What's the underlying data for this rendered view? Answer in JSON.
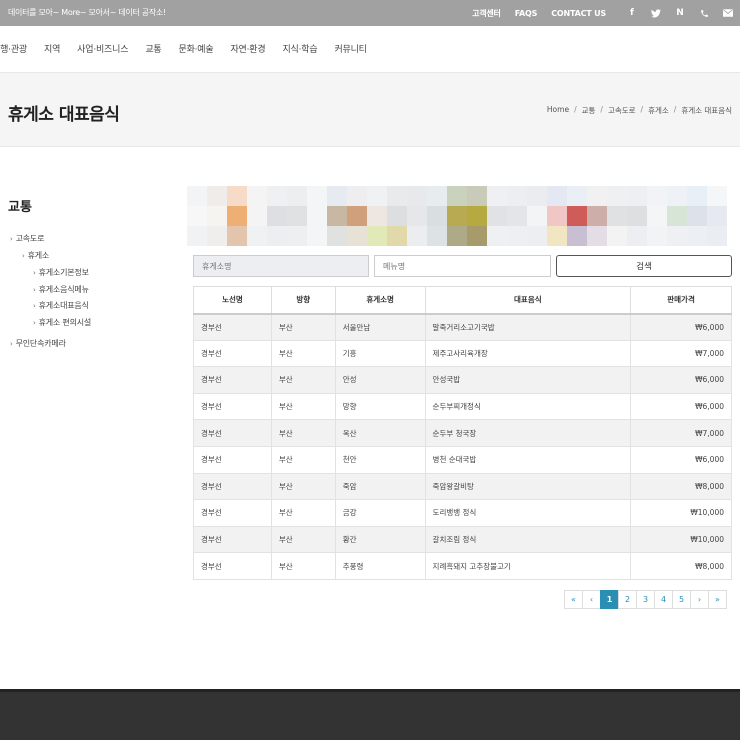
{
  "topbar": {
    "slogan": "데이터를 모아~ More~ 모아서~ 데이터 공작소!",
    "links": [
      "고객센터",
      "FAQS",
      "CONTACT US"
    ],
    "social_icons": [
      {
        "name": "facebook-icon",
        "glyph": "f"
      },
      {
        "name": "twitter-icon",
        "glyph": "🐦"
      },
      {
        "name": "naver-icon",
        "glyph": "N"
      },
      {
        "name": "phone-icon",
        "glyph": "✆"
      },
      {
        "name": "mail-icon",
        "glyph": "✉"
      }
    ]
  },
  "nav": {
    "items": [
      "여행·관광",
      "지역",
      "사업·비즈니스",
      "교통",
      "문화·예술",
      "자연·환경",
      "지식·학습",
      "커뮤니티"
    ]
  },
  "page": {
    "title": "휴게소 대표음식",
    "breadcrumb": [
      "Home",
      "교통",
      "고속도로",
      "휴게소",
      "휴게소 대표음식"
    ]
  },
  "sidebar": {
    "title": "교통",
    "items": [
      {
        "label": "고속도로",
        "level": 1
      },
      {
        "label": "휴게소",
        "level": 2
      },
      {
        "label": "휴게소기본정보",
        "level": 3
      },
      {
        "label": "휴게소음식메뉴",
        "level": 3
      },
      {
        "label": "휴게소대표음식",
        "level": 3
      },
      {
        "label": "휴게소 편의시설",
        "level": 3
      },
      {
        "label": "무인단속카메라",
        "level": 1
      }
    ]
  },
  "search": {
    "rest_area_placeholder": "휴게소명",
    "menu_placeholder": "메뉴명",
    "button_label": "검색"
  },
  "table": {
    "headers": [
      "노선명",
      "방향",
      "휴게소명",
      "대표음식",
      "판매가격"
    ],
    "rows": [
      [
        "경부선",
        "부산",
        "서울만남",
        "말죽거리소고기국밥",
        "₩6,000"
      ],
      [
        "경부선",
        "부산",
        "기흥",
        "제주고사리육개장",
        "₩7,000"
      ],
      [
        "경부선",
        "부산",
        "안성",
        "안성국밥",
        "₩6,000"
      ],
      [
        "경부선",
        "부산",
        "망향",
        "순두부찌개정식",
        "₩6,000"
      ],
      [
        "경부선",
        "부산",
        "옥산",
        "순두부 청국장",
        "₩7,000"
      ],
      [
        "경부선",
        "부산",
        "천안",
        "병천 순대국밥",
        "₩6,000"
      ],
      [
        "경부선",
        "부산",
        "죽암",
        "죽암왕갈비탕",
        "₩8,000"
      ],
      [
        "경부선",
        "부산",
        "금강",
        "도리뱅뱅 정식",
        "₩10,000"
      ],
      [
        "경부선",
        "부산",
        "황간",
        "갈치조림 정식",
        "₩10,000"
      ],
      [
        "경부선",
        "부산",
        "추풍령",
        "지례흑돼지 고추장불고기",
        "₩8,000"
      ]
    ]
  },
  "pagination": {
    "first": "«",
    "prev": "‹",
    "pages": [
      "1",
      "2",
      "3",
      "4",
      "5"
    ],
    "current": "1",
    "next": "›",
    "last": "»"
  },
  "colors": {
    "accent": "#2a8fb5",
    "topbar": "#a1a1a1",
    "footer": "#333333"
  }
}
